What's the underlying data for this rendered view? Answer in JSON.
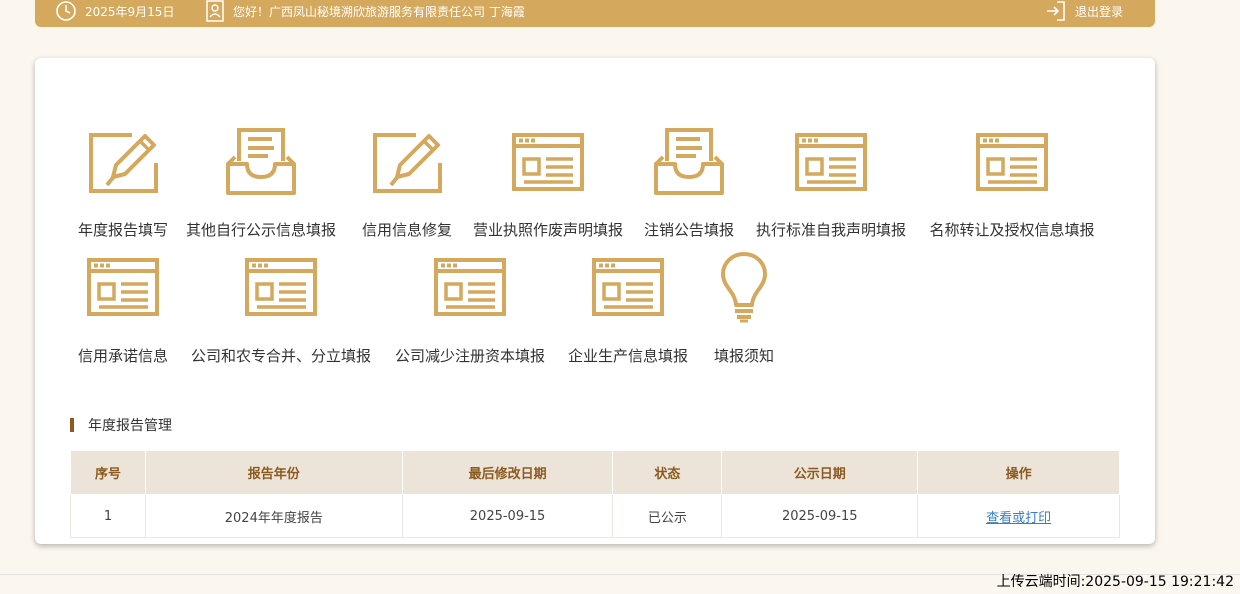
{
  "header": {
    "date": "2025年9月15日",
    "greeting": "您好！广西凤山秘境溯欣旅游服务有限责任公司 丁海霞",
    "logout": "退出登录"
  },
  "tiles_row1": [
    {
      "label": "年度报告填写",
      "icon": "edit-form-icon"
    },
    {
      "label": "其他自行公示信息填报",
      "icon": "inbox-tray-icon"
    },
    {
      "label": "信用信息修复",
      "icon": "edit-form-icon"
    },
    {
      "label": "营业执照作废声明填报",
      "icon": "browser-window-icon"
    },
    {
      "label": "注销公告填报",
      "icon": "inbox-tray-icon"
    },
    {
      "label": "执行标准自我声明填报",
      "icon": "browser-window-icon"
    },
    {
      "label": "名称转让及授权信息填报",
      "icon": "browser-window-icon"
    }
  ],
  "tiles_row2": [
    {
      "label": "信用承诺信息",
      "icon": "browser-window-icon"
    },
    {
      "label": "公司和农专合并、分立填报",
      "icon": "browser-window-icon"
    },
    {
      "label": "公司减少注册资本填报",
      "icon": "browser-window-icon"
    },
    {
      "label": "企业生产信息填报",
      "icon": "browser-window-icon"
    },
    {
      "label": "填报须知",
      "icon": "lightbulb-icon"
    }
  ],
  "report_section": {
    "title": "年度报告管理",
    "columns": [
      "序号",
      "报告年份",
      "最后修改日期",
      "状态",
      "公示日期",
      "操作"
    ],
    "rows": [
      {
        "index": "1",
        "year": "2024年年度报告",
        "modified": "2025-09-15",
        "status": "已公示",
        "publish_date": "2025-09-15",
        "action": "查看或打印"
      }
    ]
  },
  "footer": {
    "upload_time": "上传云端时间:2025-09-15 19:21:42"
  },
  "colors": {
    "brand": "#d4a95d",
    "accent_dark": "#8b5a1f",
    "table_header_bg": "#ede4d9",
    "link": "#3a7fc1"
  }
}
